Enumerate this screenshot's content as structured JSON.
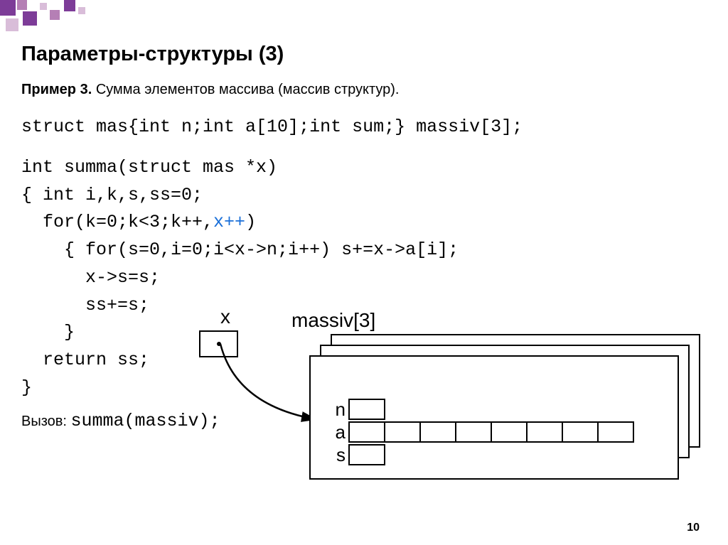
{
  "decoration": {
    "palette": [
      "#7d3c98",
      "#b57fb5",
      "#d9bdd9"
    ]
  },
  "title": "Параметры-структуры (3)",
  "subtitle_prefix": "Пример 3.",
  "subtitle_rest": " Сумма элементов массива (массив структур).",
  "code": {
    "struct_decl": "struct mas{int n;int a[10];int sum;} massiv[3];",
    "fn_sig": "int summa(struct mas *x)",
    "l1": "{ int i,k,s,ss=0;",
    "l2a": "  for(k=0;k<3;k++,",
    "l2b": "x++",
    "l2c": ")",
    "l3": "    { for(s=0,i=0;i<x->n;i++) s+=x->a[i];",
    "l4": "      x->s=s;",
    "l5": "      ss+=s;",
    "l6": "    }",
    "l7": "  return ss;",
    "l8": "}"
  },
  "diagram": {
    "pointer_label": "x",
    "array_label": "massiv[3]",
    "fields": {
      "n": "n",
      "a": "a",
      "s": "s"
    },
    "a_cells": 8
  },
  "call_prefix": "Вызов: ",
  "call_code": "summa(massiv);",
  "page_number": "10"
}
